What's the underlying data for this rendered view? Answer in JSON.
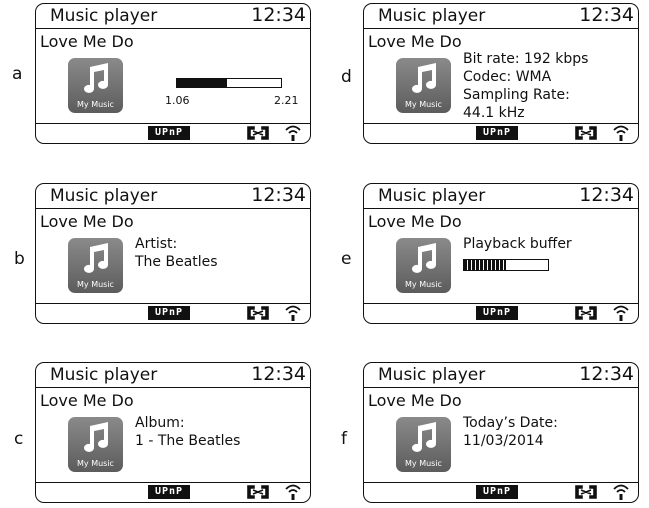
{
  "screens": [
    {
      "letter": "a",
      "title": "Music player",
      "clock": "12:34",
      "song": "Love Me Do",
      "icon_label": "My Music",
      "icon": "music-note-icon",
      "info": [],
      "progress": {
        "elapsed": "1.06",
        "total": "2.21",
        "fraction": 0.48
      }
    },
    {
      "letter": "b",
      "title": "Music player",
      "clock": "12:34",
      "song": "Love Me Do",
      "icon_label": "My Music",
      "icon": "music-note-icon",
      "info": [
        "Artist:",
        "The Beatles"
      ]
    },
    {
      "letter": "c",
      "title": "Music player",
      "clock": "12:34",
      "song": "Love Me Do",
      "icon_label": "My Music",
      "icon": "music-note-icon",
      "info": [
        "Album:",
        "1 - The Beatles"
      ]
    },
    {
      "letter": "d",
      "title": "Music player",
      "clock": "12:34",
      "song": "Love Me Do",
      "icon_label": "My Music",
      "icon": "music-note-icon",
      "info": [
        "Bit rate: 192 kbps",
        "Codec: WMA",
        "Sampling Rate:",
        "44.1 kHz"
      ]
    },
    {
      "letter": "e",
      "title": "Music player",
      "clock": "12:34",
      "song": "Love Me Do",
      "icon_label": "My Music",
      "icon": "music-note-icon",
      "info": [
        "Playback buffer"
      ],
      "buffer": {
        "fraction": 0.5
      }
    },
    {
      "letter": "f",
      "title": "Music player",
      "clock": "12:34",
      "song": "Love Me Do",
      "icon_label": "My Music",
      "icon": "music-note-icon",
      "info": [
        "Today’s Date:",
        "11/03/2014"
      ]
    }
  ],
  "footer": {
    "upnp_label": "UPnP",
    "network_icon": "network-icon",
    "wifi_icon": "wifi-icon"
  }
}
